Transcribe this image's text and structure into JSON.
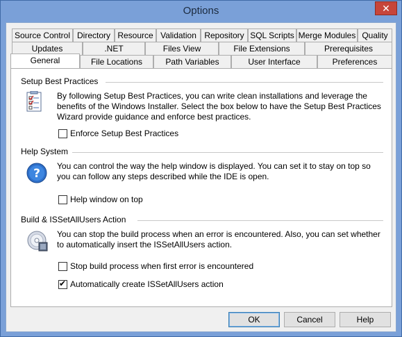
{
  "window": {
    "title": "Options",
    "close_glyph": "✕"
  },
  "tabs": {
    "row1": [
      "Source Control",
      "Directory",
      "Resource",
      "Validation",
      "Repository",
      "SQL Scripts",
      "Merge Modules",
      "Quality"
    ],
    "row2": [
      "Updates",
      ".NET",
      "Files View",
      "File Extensions",
      "Prerequisites"
    ],
    "row3": [
      "General",
      "File Locations",
      "Path Variables",
      "User Interface",
      "Preferences"
    ],
    "active": "General"
  },
  "groups": {
    "setup": {
      "title": "Setup Best Practices",
      "icon": "checklist-icon",
      "description": "By following Setup Best Practices, you can write clean installations and leverage the benefits of the Windows Installer. Select the box below to have the Setup Best Practices Wizard provide guidance and enforce best practices.",
      "checkbox_label": "Enforce Setup Best Practices",
      "checked": false
    },
    "help": {
      "title": "Help System",
      "icon": "help-icon",
      "description": "You can control the way the help window is displayed. You can set it to stay on top so you can follow any steps described while the IDE is open.",
      "checkbox_label": "Help window on top",
      "checked": false
    },
    "build": {
      "title": "Build & ISSetAllUsers Action",
      "icon": "cd-build-icon",
      "description": "You can stop the build process when an error is encountered. Also, you can set whether to automatically insert the ISSetAllUsers action.",
      "stop_label": "Stop build process when first error is encountered",
      "stop_checked": false,
      "auto_label": "Automatically create ISSetAllUsers action",
      "auto_checked": true
    }
  },
  "buttons": {
    "ok": "OK",
    "cancel": "Cancel",
    "help": "Help"
  },
  "colors": {
    "titlebar": "#7aa0d8",
    "close": "#c7453a",
    "panel": "#ffffff",
    "dialog": "#f0f0f0"
  }
}
